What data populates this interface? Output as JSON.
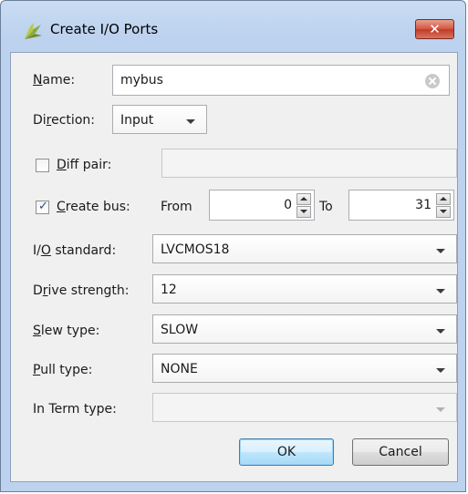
{
  "window": {
    "title": "Create I/O Ports",
    "close_label": "✕"
  },
  "form": {
    "name": {
      "label": "Name:",
      "value": "mybus"
    },
    "direction": {
      "label": "Direction:",
      "value": "Input"
    },
    "diff_pair": {
      "label": "Diff pair:",
      "checked": false,
      "value": ""
    },
    "create_bus": {
      "label": "Create bus:",
      "checked": true,
      "from_label": "From",
      "from_value": "0",
      "to_label": "To",
      "to_value": "31"
    },
    "io_standard": {
      "label": "I/O standard:",
      "value": "LVCMOS18"
    },
    "drive_strength": {
      "label": "Drive strength:",
      "value": "12"
    },
    "slew_type": {
      "label": "Slew type:",
      "value": "SLOW"
    },
    "pull_type": {
      "label": "Pull type:",
      "value": "NONE"
    },
    "in_term_type": {
      "label": "In Term type:",
      "value": ""
    }
  },
  "buttons": {
    "ok": "OK",
    "cancel": "Cancel"
  },
  "icons": {
    "app": "vivado-leaf-icon",
    "clear": "clear-icon",
    "dropdown": "chevron-down-icon"
  },
  "colors": {
    "titlebar": "#bcd2ee",
    "client": "#f0f0f0",
    "close": "#c13b26",
    "ok_accent": "#3c7fb1"
  }
}
